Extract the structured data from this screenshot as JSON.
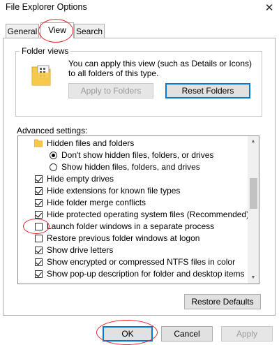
{
  "window": {
    "title": "File Explorer Options",
    "close_glyph": "✕"
  },
  "tabs": [
    {
      "label": "General"
    },
    {
      "label": "View",
      "active": true
    },
    {
      "label": "Search"
    }
  ],
  "folder_views": {
    "label": "Folder views",
    "description": "You can apply this view (such as Details or Icons) to all folders of this type.",
    "apply_button": "Apply to Folders",
    "reset_button": "Reset Folders"
  },
  "advanced": {
    "label": "Advanced settings:",
    "items": [
      {
        "type": "folder",
        "label": "Hidden files and folders",
        "indent": 0
      },
      {
        "type": "radio",
        "label": "Don't show hidden files, folders, or drives",
        "checked": true,
        "indent": 1
      },
      {
        "type": "radio",
        "label": "Show hidden files, folders, and drives",
        "checked": false,
        "indent": 1
      },
      {
        "type": "checkbox",
        "label": "Hide empty drives",
        "checked": true,
        "indent": 0
      },
      {
        "type": "checkbox",
        "label": "Hide extensions for known file types",
        "checked": true,
        "indent": 0
      },
      {
        "type": "checkbox",
        "label": "Hide folder merge conflicts",
        "checked": true,
        "indent": 0
      },
      {
        "type": "checkbox",
        "label": "Hide protected operating system files (Recommended)",
        "checked": true,
        "indent": 0
      },
      {
        "type": "checkbox",
        "label": "Launch folder windows in a separate process",
        "checked": false,
        "indent": 0
      },
      {
        "type": "checkbox",
        "label": "Restore previous folder windows at logon",
        "checked": false,
        "indent": 0
      },
      {
        "type": "checkbox",
        "label": "Show drive letters",
        "checked": true,
        "indent": 0
      },
      {
        "type": "checkbox",
        "label": "Show encrypted or compressed NTFS files in color",
        "checked": true,
        "indent": 0
      },
      {
        "type": "checkbox",
        "label": "Show pop-up description for folder and desktop items",
        "checked": true,
        "indent": 0
      }
    ],
    "restore_button": "Restore Defaults"
  },
  "footer": {
    "ok": "OK",
    "cancel": "Cancel",
    "apply": "Apply"
  },
  "colors": {
    "accent": "#0078d7",
    "annotation": "#e8242b",
    "folder": "#f6c94a"
  }
}
